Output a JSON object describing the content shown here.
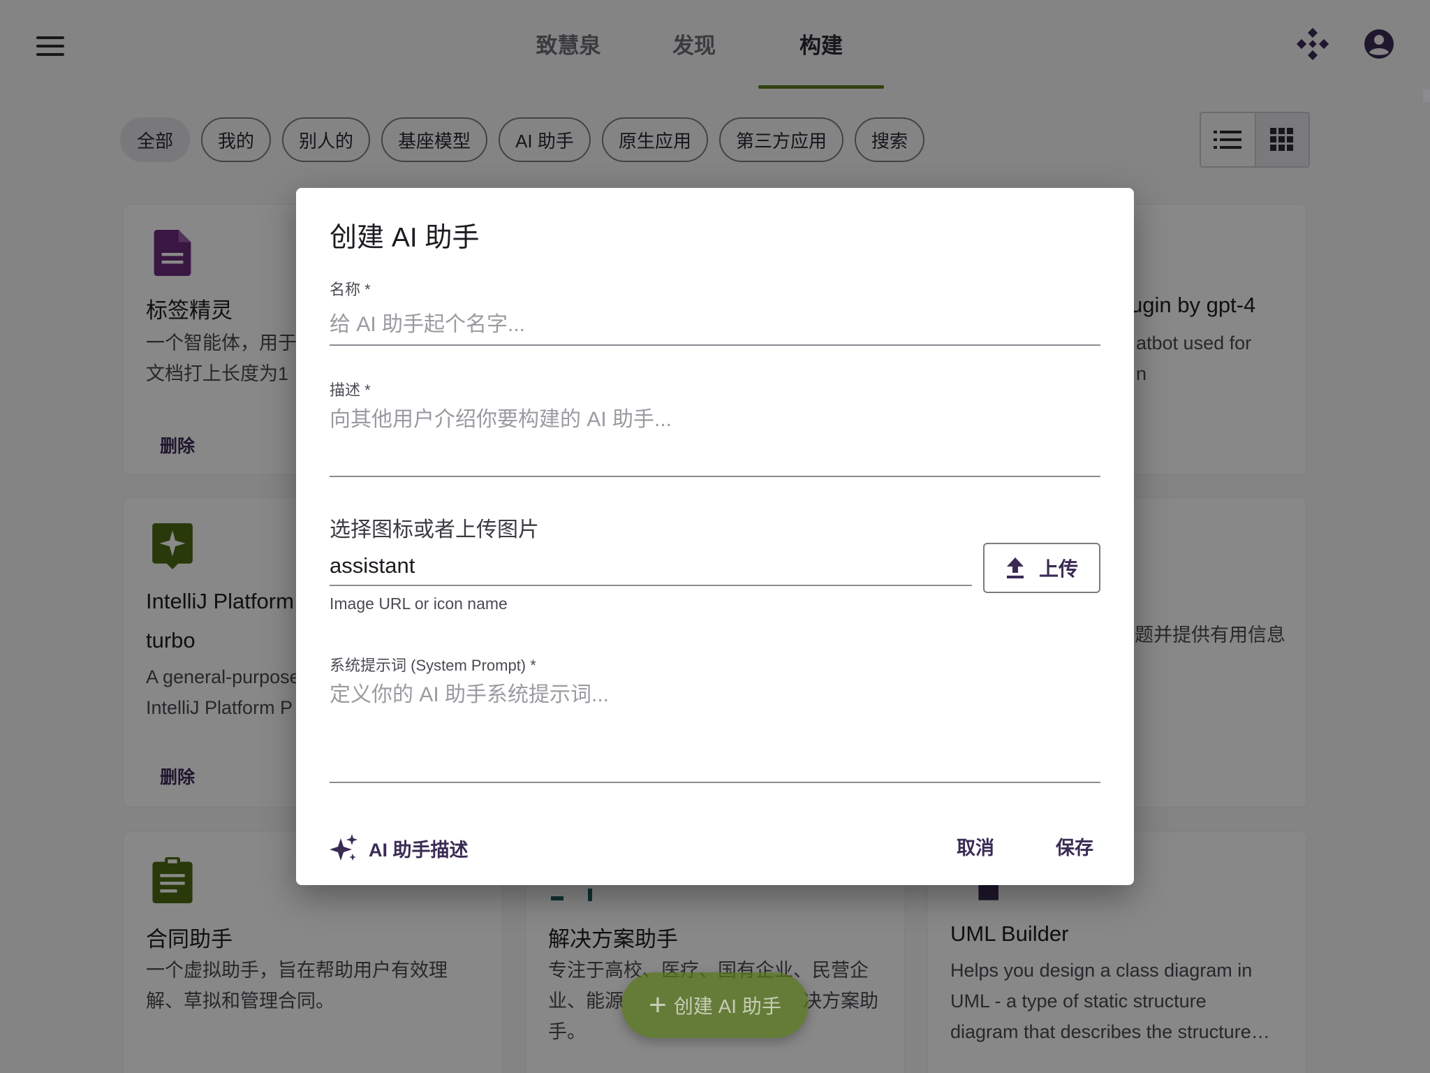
{
  "header": {
    "tabs": [
      {
        "label": "致慧泉"
      },
      {
        "label": "发现"
      },
      {
        "label": "构建"
      }
    ]
  },
  "filters": {
    "chips": [
      "全部",
      "我的",
      "别人的",
      "基座模型",
      "AI 助手",
      "原生应用",
      "第三方应用",
      "搜索"
    ]
  },
  "cards": [
    {
      "title": "标签精灵",
      "desc_1": "一个智能体，用于",
      "desc_2": "文档打上长度为1",
      "delete": "删除",
      "icon": "document-icon"
    },
    {
      "title": "",
      "desc_1": "ugin by gpt-4",
      "desc_2": "atbot used for",
      "desc_3": "n",
      "icon": ""
    },
    {
      "title_1": "IntelliJ Platform",
      "title_2": "turbo",
      "desc_1": "A general-purpose",
      "desc_2": "IntelliJ Platform P",
      "delete": "删除",
      "icon": "sparkle-badge-icon"
    },
    {
      "desc_1": "题并提供有用信息",
      "icon": ""
    },
    {
      "title": "合同助手",
      "desc_1": "一个虚拟助手，旨在帮助用户有效理",
      "desc_2": "解、草拟和管理合同。",
      "icon": "clipboard-icon"
    },
    {
      "title": "解决方案助手",
      "desc_1": "专注于高校、医疗、国有企业、民营企",
      "desc_2": "业、能源",
      "desc_2b": "决方案助",
      "desc_3": "手。",
      "icon": "frame-icon"
    },
    {
      "title": "UML Builder",
      "desc_1": "Helps you design a class diagram in",
      "desc_2": "UML - a type of static structure",
      "desc_3": "diagram that describes the structure…",
      "icon": "diagram-icon"
    }
  ],
  "fab": {
    "label": "创建 AI 助手"
  },
  "dialog": {
    "title": "创建 AI 助手",
    "name": {
      "label": "名称 *",
      "placeholder": "给 AI 助手起个名字..."
    },
    "description": {
      "label": "描述 *",
      "placeholder": "向其他用户介绍你要构建的 AI 助手..."
    },
    "icon_field": {
      "label": "选择图标或者上传图片",
      "value": "assistant",
      "helper": "Image URL or icon name",
      "upload_label": "上传"
    },
    "system_prompt": {
      "label": "系统提示词 (System Prompt) *",
      "placeholder": "定义你的 AI 助手系统提示词..."
    },
    "footer": {
      "ai_describe": "AI 助手描述",
      "cancel": "取消",
      "save": "保存"
    }
  },
  "colors": {
    "accent": "#58781c",
    "primary_text": "#3a2b55",
    "icon_purple": "#6a2c7a",
    "icon_olive": "#4d6a14"
  }
}
